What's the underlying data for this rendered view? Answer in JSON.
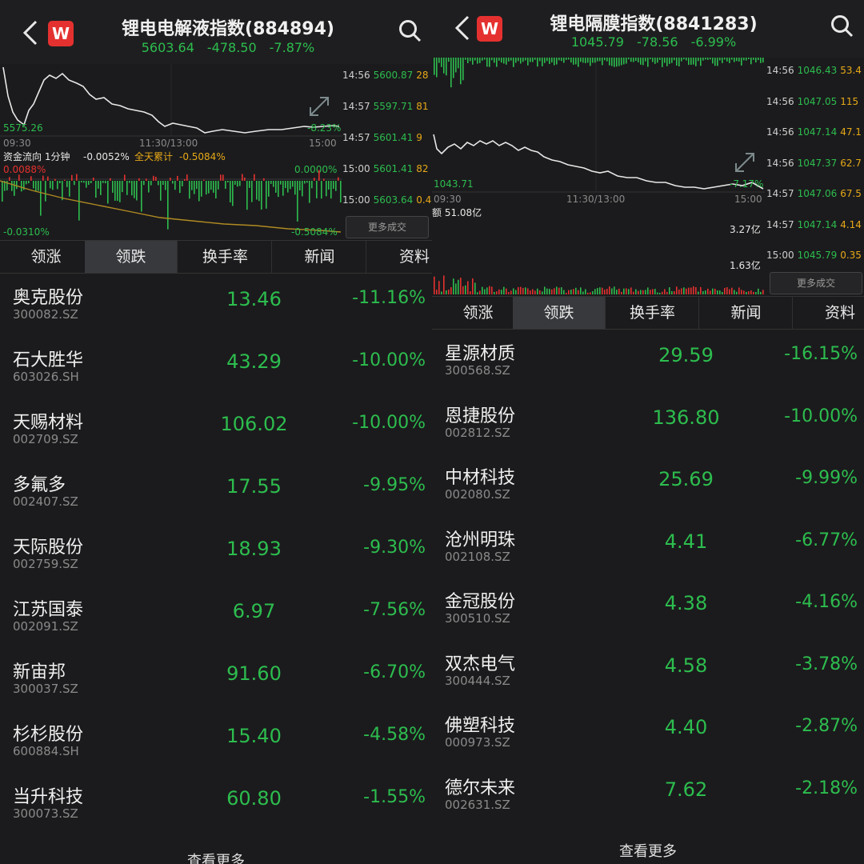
{
  "left": {
    "header": {
      "title": "锂电电解液指数(884894)",
      "price": "5603.64",
      "change": "-478.50",
      "change_pct": "-7.87%"
    },
    "chart": {
      "low_label": "5575.26",
      "pct_label": "-8.23%",
      "time_start": "09:30",
      "time_mid": "11:30/13:00",
      "time_end": "15:00",
      "flow_label": "资金流向 1分钟",
      "flow_value": "-0.0052%",
      "flow_total_label": "全天累计",
      "flow_total_value": "-0.5084%",
      "flow_top": "0.0088%",
      "flow_zero": "0.0000%",
      "flow_min": "-0.0310%",
      "flow_end": "-0.5084%"
    },
    "ticks": [
      {
        "t": "14:56",
        "p": "5600.87",
        "v": "28"
      },
      {
        "t": "14:57",
        "p": "5597.71",
        "v": "81"
      },
      {
        "t": "14:57",
        "p": "5601.41",
        "v": "9"
      },
      {
        "t": "15:00",
        "p": "5601.41",
        "v": "82"
      },
      {
        "t": "15:00",
        "p": "5603.64",
        "v": "0.4"
      }
    ],
    "more_deals": "更多成交",
    "tabs": [
      "领涨",
      "领跌",
      "换手率",
      "新闻",
      "资料"
    ],
    "rows": [
      {
        "name": "奥克股份",
        "code": "300082.SZ",
        "price": "13.46",
        "pct": "-11.16%"
      },
      {
        "name": "石大胜华",
        "code": "603026.SH",
        "price": "43.29",
        "pct": "-10.00%"
      },
      {
        "name": "天赐材料",
        "code": "002709.SZ",
        "price": "106.02",
        "pct": "-10.00%"
      },
      {
        "name": "多氟多",
        "code": "002407.SZ",
        "price": "17.55",
        "pct": "-9.95%"
      },
      {
        "name": "天际股份",
        "code": "002759.SZ",
        "price": "18.93",
        "pct": "-9.30%"
      },
      {
        "name": "江苏国泰",
        "code": "002091.SZ",
        "price": "6.97",
        "pct": "-7.56%"
      },
      {
        "name": "新宙邦",
        "code": "300037.SZ",
        "price": "91.60",
        "pct": "-6.70%"
      },
      {
        "name": "杉杉股份",
        "code": "600884.SH",
        "price": "15.40",
        "pct": "-4.58%"
      },
      {
        "name": "当升科技",
        "code": "300073.SZ",
        "price": "60.80",
        "pct": "-1.55%"
      }
    ],
    "see_more": "查看更多"
  },
  "right": {
    "header": {
      "title": "锂电隔膜指数(8841283)",
      "price": "1045.79",
      "change": "-78.56",
      "change_pct": "-6.99%"
    },
    "chart": {
      "low_label": "1043.71",
      "pct_label": "-7.17%",
      "time_start": "09:30",
      "time_mid": "11:30/13:00",
      "time_end": "15:00",
      "vol_label": "额 51.08亿",
      "vol_high": "3.27亿",
      "vol_mid": "1.63亿"
    },
    "ticks": [
      {
        "t": "14:56",
        "p": "1046.43",
        "v": "53.4"
      },
      {
        "t": "14:56",
        "p": "1047.05",
        "v": "115"
      },
      {
        "t": "14:56",
        "p": "1047.14",
        "v": "47.1"
      },
      {
        "t": "14:56",
        "p": "1047.37",
        "v": "62.7"
      },
      {
        "t": "14:57",
        "p": "1047.06",
        "v": "67.5"
      },
      {
        "t": "14:57",
        "p": "1047.14",
        "v": "4.14"
      },
      {
        "t": "15:00",
        "p": "1045.79",
        "v": "0.35"
      }
    ],
    "more_deals": "更多成交",
    "tabs": [
      "领涨",
      "领跌",
      "换手率",
      "新闻",
      "资料"
    ],
    "rows": [
      {
        "name": "星源材质",
        "code": "300568.SZ",
        "price": "29.59",
        "pct": "-16.15%"
      },
      {
        "name": "恩捷股份",
        "code": "002812.SZ",
        "price": "136.80",
        "pct": "-10.00%"
      },
      {
        "name": "中材科技",
        "code": "002080.SZ",
        "price": "25.69",
        "pct": "-9.99%"
      },
      {
        "name": "沧州明珠",
        "code": "002108.SZ",
        "price": "4.41",
        "pct": "-6.77%"
      },
      {
        "name": "金冠股份",
        "code": "300510.SZ",
        "price": "4.38",
        "pct": "-4.16%"
      },
      {
        "name": "双杰电气",
        "code": "300444.SZ",
        "price": "4.58",
        "pct": "-3.78%"
      },
      {
        "name": "佛塑科技",
        "code": "000973.SZ",
        "price": "4.40",
        "pct": "-2.87%"
      },
      {
        "name": "德尔未来",
        "code": "002631.SZ",
        "price": "7.62",
        "pct": "-2.18%"
      }
    ],
    "see_more": "查看更多"
  },
  "colors": {
    "down": "#2dbd4e",
    "up": "#e4312f",
    "volume": "#e6a817",
    "bg": "#1b1b1d",
    "active_tab": "#38393d"
  },
  "icons": {
    "back": "chevron-left-icon",
    "brand": "w-logo-icon",
    "search": "search-icon",
    "expand": "expand-icon"
  }
}
